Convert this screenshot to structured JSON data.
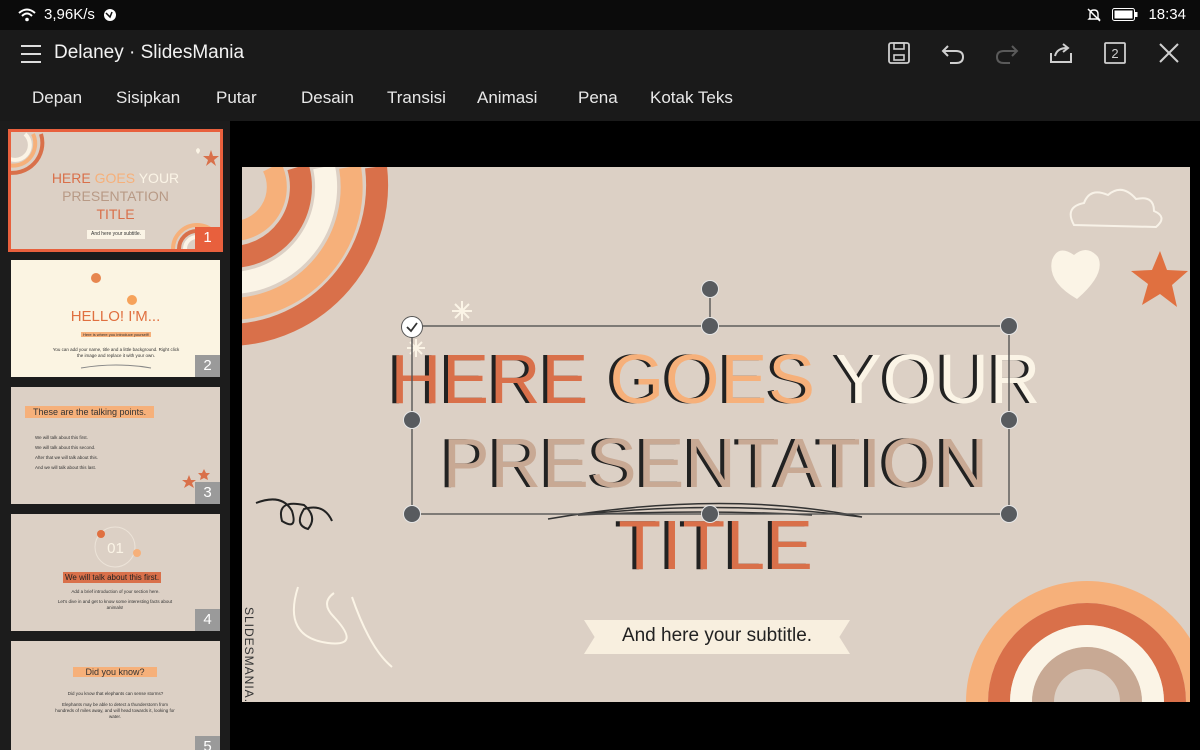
{
  "status": {
    "speed": "3,96K/s",
    "time": "18:34"
  },
  "app": {
    "title": "Delaney · SlidesMania",
    "page_count": "2"
  },
  "tabs": [
    "Depan",
    "Sisipkan",
    "Putar",
    "Desain",
    "Transisi",
    "Animasi",
    "Pena",
    "Kotak Teks"
  ],
  "thumbnails": [
    {
      "number": "1",
      "title_a": "HERE",
      "title_b": "GOES",
      "title_c": "YOUR",
      "line2": "PRESENTATION",
      "line3": "TITLE",
      "subtitle": "And here your subtitle."
    },
    {
      "number": "2",
      "title": "HELLO! I'M...",
      "intro": "Here is where you introduce yourself!",
      "body": "You can add your name, title and a little background. Right click the image and replace it with your own."
    },
    {
      "number": "3",
      "title": "These are the talking points.",
      "bullets": [
        "We will talk about this first.",
        "We will talk about this second.",
        "After that we will talk about this.",
        "And we will talk about this last."
      ]
    },
    {
      "number": "4",
      "section_num": "01",
      "title": "We will talk about this first.",
      "line1": "Add a brief introduction of your section here.",
      "line2": "Let's dive in and get to know some interesting facts about animals!"
    },
    {
      "number": "5",
      "title": "Did you know?",
      "line1": "Did you know that elephants can sense storms?",
      "line2": "Elephants may be able to detect a thunderstorm from hundreds of miles away, and will head towards it, looking for water."
    }
  ],
  "slide": {
    "title_word1": "HERE",
    "title_word2": "GOES",
    "title_word3": "YOUR",
    "title_line2": "PRESENTATION",
    "title_line3": "TITLE",
    "subtitle": "And here your subtitle.",
    "watermark": "SLIDESMANIA.CO"
  },
  "colors": {
    "accent": "#e8603d",
    "rust": "#d9704a",
    "peach": "#f6b07a",
    "cream": "#fbf4e6",
    "tan": "#c8a994",
    "slide_bg": "#dcd0c5"
  }
}
